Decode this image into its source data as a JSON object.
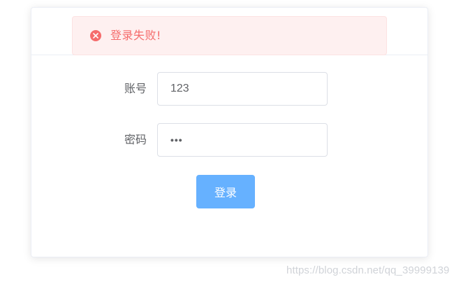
{
  "alert": {
    "type": "error",
    "icon": "error-circle-icon",
    "message": "登录失败!",
    "color": "#f56c6c",
    "background": "#fef0f0"
  },
  "form": {
    "account": {
      "label": "账号",
      "value": "123"
    },
    "password": {
      "label": "密码",
      "value": "•••"
    },
    "submit_label": "登录"
  },
  "colors": {
    "primary_light": "#66b1ff",
    "label": "#606266",
    "border": "#dcdfe6"
  },
  "watermark": {
    "text": "https://blog.csdn.net/qq_39999139"
  }
}
